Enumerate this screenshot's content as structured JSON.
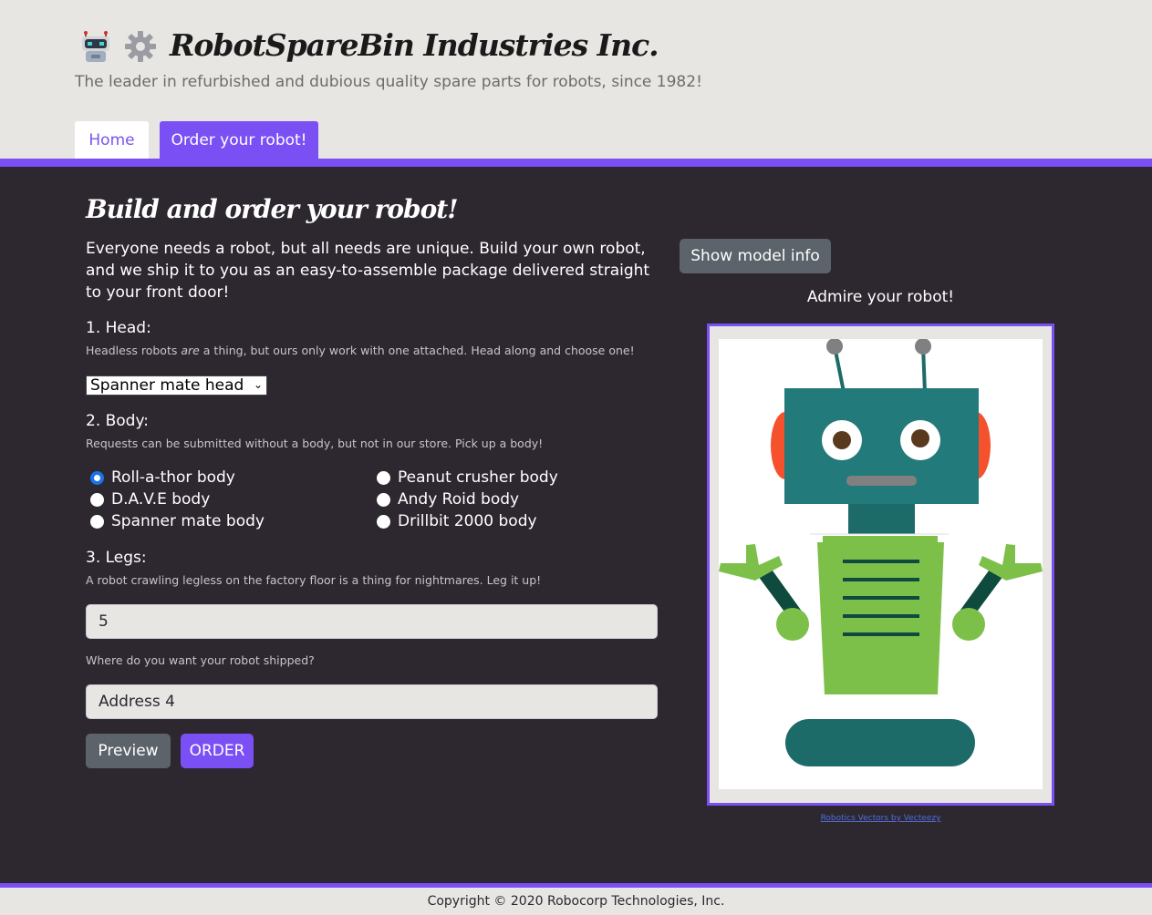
{
  "header": {
    "title": "RobotSpareBin Industries Inc.",
    "tagline": "The leader in refurbished and dubious quality spare parts for robots, since 1982!",
    "logo_icons": [
      "robot-icon",
      "gear-icon"
    ]
  },
  "nav": {
    "tabs": [
      {
        "label": "Home",
        "active": false
      },
      {
        "label": "Order your robot!",
        "active": true
      }
    ]
  },
  "form": {
    "title": "Build and order your robot!",
    "intro": "Everyone needs a robot, but all needs are unique. Build your own robot, and we ship it to you as an easy-to-assemble package delivered straight to your front door!",
    "head": {
      "label": "1. Head:",
      "help_before": "Headless robots ",
      "help_em": "are",
      "help_after": " a thing, but ours only work with one attached. Head along and choose one!",
      "selected": "Spanner mate head"
    },
    "body": {
      "label": "2. Body:",
      "help": "Requests can be submitted without a body, but not in our store. Pick up a body!",
      "options": [
        {
          "label": "Roll-a-thor body",
          "checked": true
        },
        {
          "label": "Peanut crusher body",
          "checked": false
        },
        {
          "label": "D.A.V.E body",
          "checked": false
        },
        {
          "label": "Andy Roid body",
          "checked": false
        },
        {
          "label": "Spanner mate body",
          "checked": false
        },
        {
          "label": "Drillbit 2000 body",
          "checked": false
        }
      ]
    },
    "legs": {
      "label": "3. Legs:",
      "help": "A robot crawling legless on the factory floor is a thing for nightmares. Leg it up!",
      "value": "5"
    },
    "address": {
      "help": "Where do you want your robot shipped?",
      "value": "Address 4"
    },
    "buttons": {
      "preview": "Preview",
      "order": "ORDER"
    }
  },
  "preview": {
    "show_info_button": "Show model info",
    "caption": "Admire your robot!",
    "credit": "Robotics Vectors by Vecteezy"
  },
  "footer": {
    "copyright": "Copyright © 2020 Robocorp Technologies, Inc."
  },
  "colors": {
    "accent": "#7a4ff3",
    "main_bg": "#2d2730",
    "page_bg": "#e8e6e3",
    "secondary_button": "#5c636a"
  }
}
